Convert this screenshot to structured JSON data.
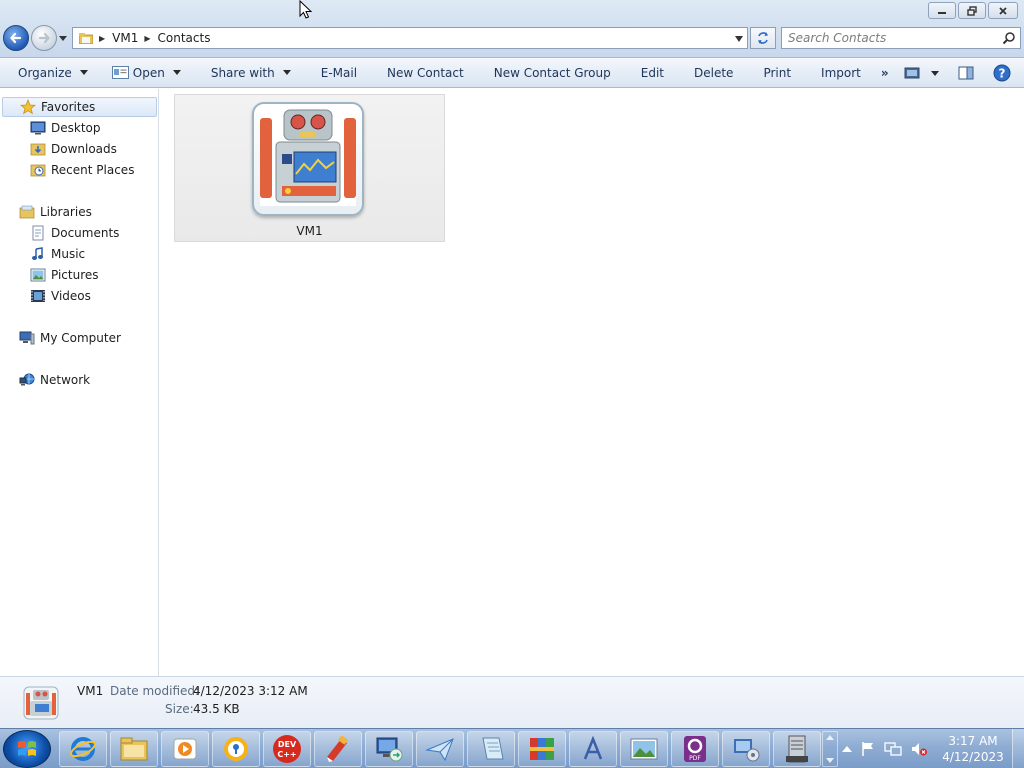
{
  "window": {
    "breadcrumb": [
      "VM1",
      "Contacts"
    ],
    "search_placeholder": "Search Contacts"
  },
  "toolbar": {
    "organize": "Organize",
    "open": "Open",
    "share_with": "Share with",
    "email": "E-Mail",
    "new_contact": "New Contact",
    "new_contact_group": "New Contact Group",
    "edit": "Edit",
    "delete": "Delete",
    "print": "Print",
    "import": "Import",
    "overflow": "»"
  },
  "sidebar": {
    "favorites": {
      "label": "Favorites",
      "items": [
        {
          "label": "Desktop",
          "icon": "desktop-icon"
        },
        {
          "label": "Downloads",
          "icon": "downloads-folder-icon"
        },
        {
          "label": "Recent Places",
          "icon": "recent-places-icon"
        }
      ]
    },
    "libraries": {
      "label": "Libraries",
      "items": [
        {
          "label": "Documents",
          "icon": "documents-icon"
        },
        {
          "label": "Music",
          "icon": "music-icon"
        },
        {
          "label": "Pictures",
          "icon": "pictures-icon"
        },
        {
          "label": "Videos",
          "icon": "videos-icon"
        }
      ]
    },
    "computer": {
      "label": "My Computer",
      "icon": "computer-icon"
    },
    "network": {
      "label": "Network",
      "icon": "network-icon"
    }
  },
  "content": {
    "items": [
      {
        "name": "VM1",
        "icon": "contact-robot-icon"
      }
    ]
  },
  "details": {
    "name": "VM1",
    "date_modified_label": "Date modified:",
    "date_modified": "4/12/2023 3:12 AM",
    "size_label": "Size:",
    "size": "43.5 KB"
  },
  "taskbar": {
    "apps": [
      "internet-explorer",
      "windows-explorer",
      "media-player",
      "security-app",
      "dev-cpp",
      "ccleaner",
      "remote-desktop",
      "mail-send",
      "notepad",
      "winrar",
      "font-app",
      "photo-viewer",
      "pdf-app",
      "control-panel",
      "server-manager"
    ],
    "devcpp_text": "DEV C++",
    "pdf_text": "PDF",
    "clock_time": "3:17 AM",
    "clock_date": "4/12/2023"
  },
  "colors": {
    "accent": "#2159b7",
    "taskbar": "#8fadd3",
    "selection": "#dce8f8"
  }
}
